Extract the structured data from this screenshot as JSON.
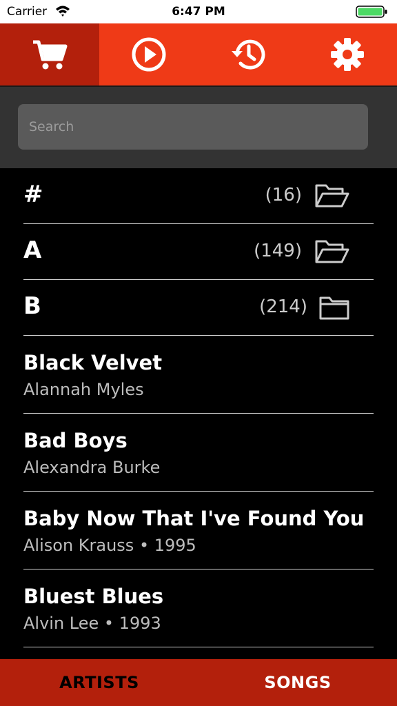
{
  "status_bar": {
    "carrier": "Carrier",
    "time": "6:47 PM"
  },
  "toolbar": {
    "tabs": [
      {
        "icon": "cart-icon",
        "active": true
      },
      {
        "icon": "play-icon",
        "active": false
      },
      {
        "icon": "history-icon",
        "active": false
      },
      {
        "icon": "gear-icon",
        "active": false
      }
    ]
  },
  "search": {
    "placeholder": "Search",
    "value": ""
  },
  "groups": [
    {
      "letter": "#",
      "count": "(16)",
      "icon": "folder-open-icon"
    },
    {
      "letter": "A",
      "count": "(149)",
      "icon": "folder-open-icon"
    },
    {
      "letter": "B",
      "count": "(214)",
      "icon": "folder-icon"
    }
  ],
  "songs": [
    {
      "title": "Black Velvet",
      "subtitle": "Alannah Myles"
    },
    {
      "title": "Bad Boys",
      "subtitle": "Alexandra Burke"
    },
    {
      "title": "Baby Now That I've Found You",
      "subtitle": "Alison Krauss • 1995"
    },
    {
      "title": "Bluest Blues",
      "subtitle": "Alvin Lee • 1993"
    }
  ],
  "bottom_tabs": {
    "artists": "ARTISTS",
    "songs": "SONGS",
    "active": "songs"
  },
  "colors": {
    "accent": "#ef3a17",
    "accent_dark": "#b3200c",
    "background": "#000000",
    "search_bg": "#333333"
  }
}
